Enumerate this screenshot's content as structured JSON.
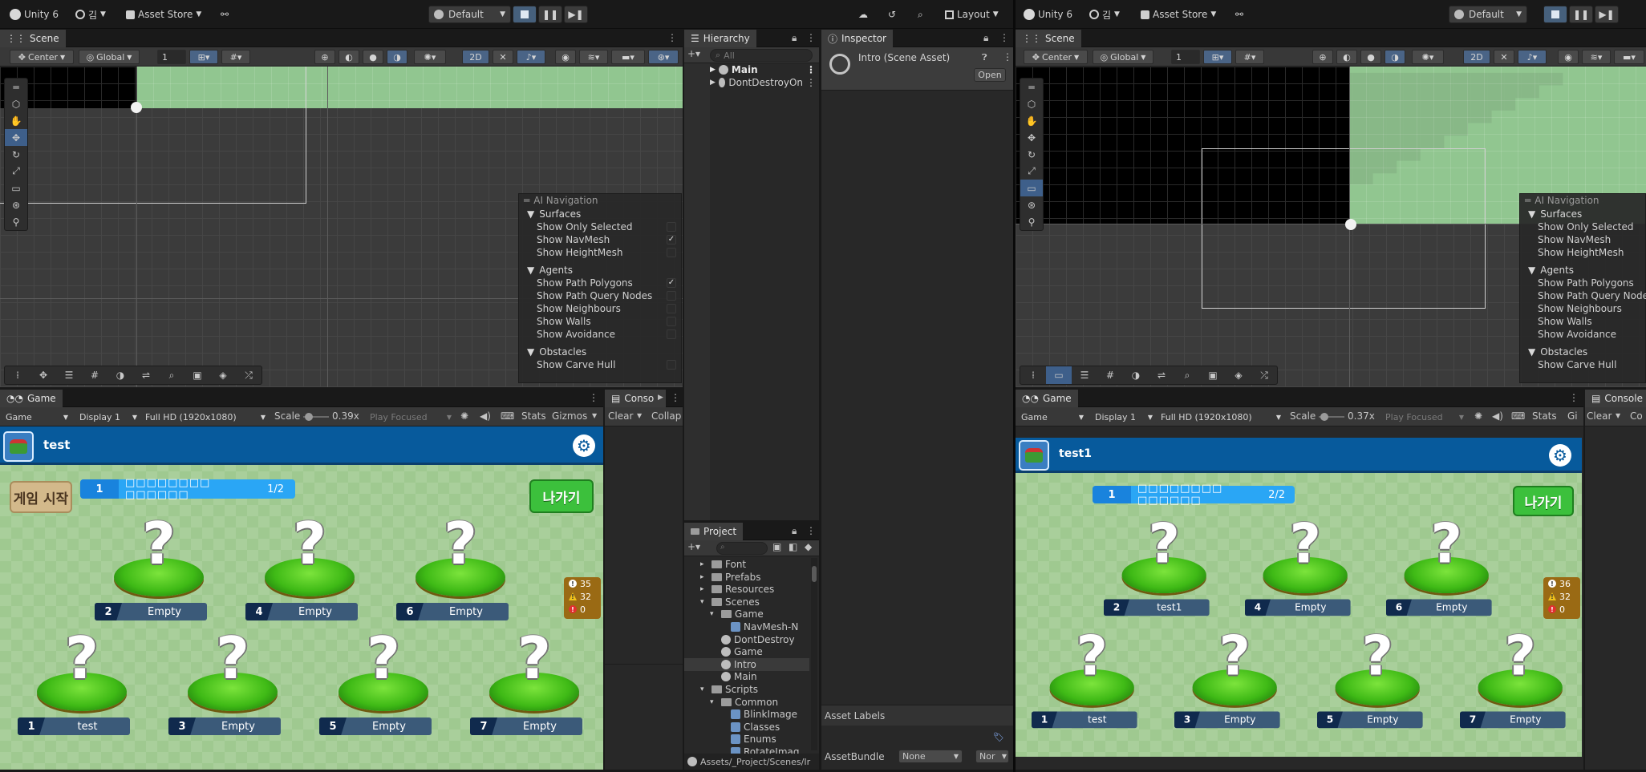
{
  "left": {
    "topbar": {
      "account": "Unity 6",
      "user": "김",
      "asset_store": "Asset Store",
      "layout_mode": "Default",
      "layout": "Layout"
    },
    "scene": {
      "tab": "Scene",
      "pivot": "Center",
      "space": "Global",
      "grid_snap": "1",
      "mode_2d": "2D"
    },
    "ai_nav": {
      "title": "AI Navigation",
      "sections": [
        {
          "name": "Surfaces",
          "rows": [
            {
              "label": "Show Only Selected",
              "checked": false
            },
            {
              "label": "Show NavMesh",
              "checked": true
            },
            {
              "label": "Show HeightMesh",
              "checked": false
            }
          ]
        },
        {
          "name": "Agents",
          "rows": [
            {
              "label": "Show Path Polygons",
              "checked": true
            },
            {
              "label": "Show Path Query Nodes",
              "checked": false
            },
            {
              "label": "Show Neighbours",
              "checked": false
            },
            {
              "label": "Show Walls",
              "checked": false
            },
            {
              "label": "Show Avoidance",
              "checked": false
            }
          ]
        },
        {
          "name": "Obstacles",
          "rows": [
            {
              "label": "Show Carve Hull",
              "checked": false
            }
          ]
        }
      ]
    },
    "game": {
      "tab": "Game",
      "view": "Game",
      "display": "Display 1",
      "resolution": "Full HD (1920x1080)",
      "scale_label": "Scale",
      "scale": "0.39x",
      "play_focused": "Play Focused",
      "stats": "Stats",
      "gizmos": "Gizmos",
      "player_name": "test",
      "start_button": "게임 시작",
      "exit_button": "나가기",
      "room_number": "1",
      "room_title": "□□□□□□□□ □□□□□□",
      "room_count": "1/2",
      "slots": [
        {
          "num": "2",
          "name": "Empty"
        },
        {
          "num": "4",
          "name": "Empty"
        },
        {
          "num": "6",
          "name": "Empty"
        },
        {
          "num": "1",
          "name": "test"
        },
        {
          "num": "3",
          "name": "Empty"
        },
        {
          "num": "5",
          "name": "Empty"
        },
        {
          "num": "7",
          "name": "Empty"
        }
      ],
      "counters": {
        "info": "35",
        "warn": "32",
        "error": "0"
      }
    },
    "console": {
      "tab": "Conso",
      "clear": "Clear",
      "collapse": "Collap"
    },
    "hierarchy": {
      "tab": "Hierarchy",
      "search_placeholder": "All",
      "items": [
        "Main",
        "DontDestroyOn"
      ]
    },
    "inspector": {
      "tab": "Inspector",
      "title": "Intro (Scene Asset)",
      "open": "Open",
      "asset_labels": "Asset Labels",
      "asset_bundle": "AssetBundle",
      "bundle_value": "None",
      "variant_value": "Nor"
    },
    "project": {
      "tab": "Project",
      "items": [
        {
          "label": "Font",
          "kind": "folder",
          "level": 2,
          "arrow": "▸"
        },
        {
          "label": "Prefabs",
          "kind": "folder",
          "level": 2,
          "arrow": "▸"
        },
        {
          "label": "Resources",
          "kind": "folder",
          "level": 2,
          "arrow": "▸"
        },
        {
          "label": "Scenes",
          "kind": "folder",
          "level": 2,
          "arrow": "▾"
        },
        {
          "label": "Game",
          "kind": "folder",
          "level": 3,
          "arrow": "▾"
        },
        {
          "label": "NavMesh-N",
          "kind": "asset",
          "level": 4,
          "arrow": ""
        },
        {
          "label": "DontDestroy",
          "kind": "scene",
          "level": 3,
          "arrow": ""
        },
        {
          "label": "Game",
          "kind": "scene",
          "level": 3,
          "arrow": ""
        },
        {
          "label": "Intro",
          "kind": "scene",
          "level": 3,
          "arrow": ""
        },
        {
          "label": "Main",
          "kind": "scene",
          "level": 3,
          "arrow": ""
        },
        {
          "label": "Scripts",
          "kind": "folder",
          "level": 2,
          "arrow": "▾"
        },
        {
          "label": "Common",
          "kind": "folder",
          "level": 3,
          "arrow": "▾"
        },
        {
          "label": "BlinkImage",
          "kind": "script",
          "level": 4,
          "arrow": ""
        },
        {
          "label": "Classes",
          "kind": "script",
          "level": 4,
          "arrow": ""
        },
        {
          "label": "Enums",
          "kind": "script",
          "level": 4,
          "arrow": ""
        },
        {
          "label": "RotateImag",
          "kind": "script",
          "level": 4,
          "arrow": ""
        }
      ],
      "selected": "Intro",
      "path": "Assets/_Project/Scenes/Ir"
    }
  },
  "right": {
    "topbar": {
      "account": "Unity 6",
      "user": "김",
      "asset_store": "Asset Store",
      "layout_mode": "Default"
    },
    "scene": {
      "tab": "Scene",
      "pivot": "Center",
      "space": "Global",
      "grid_snap": "1",
      "mode_2d": "2D"
    },
    "ai_nav": {
      "title": "AI Navigation",
      "sections": [
        {
          "name": "Surfaces",
          "rows": [
            {
              "label": "Show Only Selected"
            },
            {
              "label": "Show NavMesh"
            },
            {
              "label": "Show HeightMesh"
            }
          ]
        },
        {
          "name": "Agents",
          "rows": [
            {
              "label": "Show Path Polygons"
            },
            {
              "label": "Show Path Query Nodes"
            },
            {
              "label": "Show Neighbours"
            },
            {
              "label": "Show Walls"
            },
            {
              "label": "Show Avoidance"
            }
          ]
        },
        {
          "name": "Obstacles",
          "rows": [
            {
              "label": "Show Carve Hull"
            }
          ]
        }
      ]
    },
    "game": {
      "tab": "Game",
      "view": "Game",
      "display": "Display 1",
      "resolution": "Full HD (1920x1080)",
      "scale_label": "Scale",
      "scale": "0.37x",
      "play_focused": "Play Focused",
      "stats": "Stats",
      "gizmos": "Gi",
      "player_name": "test1",
      "exit_button": "나가기",
      "room_number": "1",
      "room_title": "□□□□□□□□ □□□□□□",
      "room_count": "2/2",
      "slots": [
        {
          "num": "2",
          "name": "test1"
        },
        {
          "num": "4",
          "name": "Empty"
        },
        {
          "num": "6",
          "name": "Empty"
        },
        {
          "num": "1",
          "name": "test"
        },
        {
          "num": "3",
          "name": "Empty"
        },
        {
          "num": "5",
          "name": "Empty"
        },
        {
          "num": "7",
          "name": "Empty"
        }
      ],
      "counters": {
        "info": "36",
        "warn": "32",
        "error": "0"
      }
    },
    "console": {
      "tab": "Console",
      "clear": "Clear",
      "collapse": "Co"
    }
  }
}
